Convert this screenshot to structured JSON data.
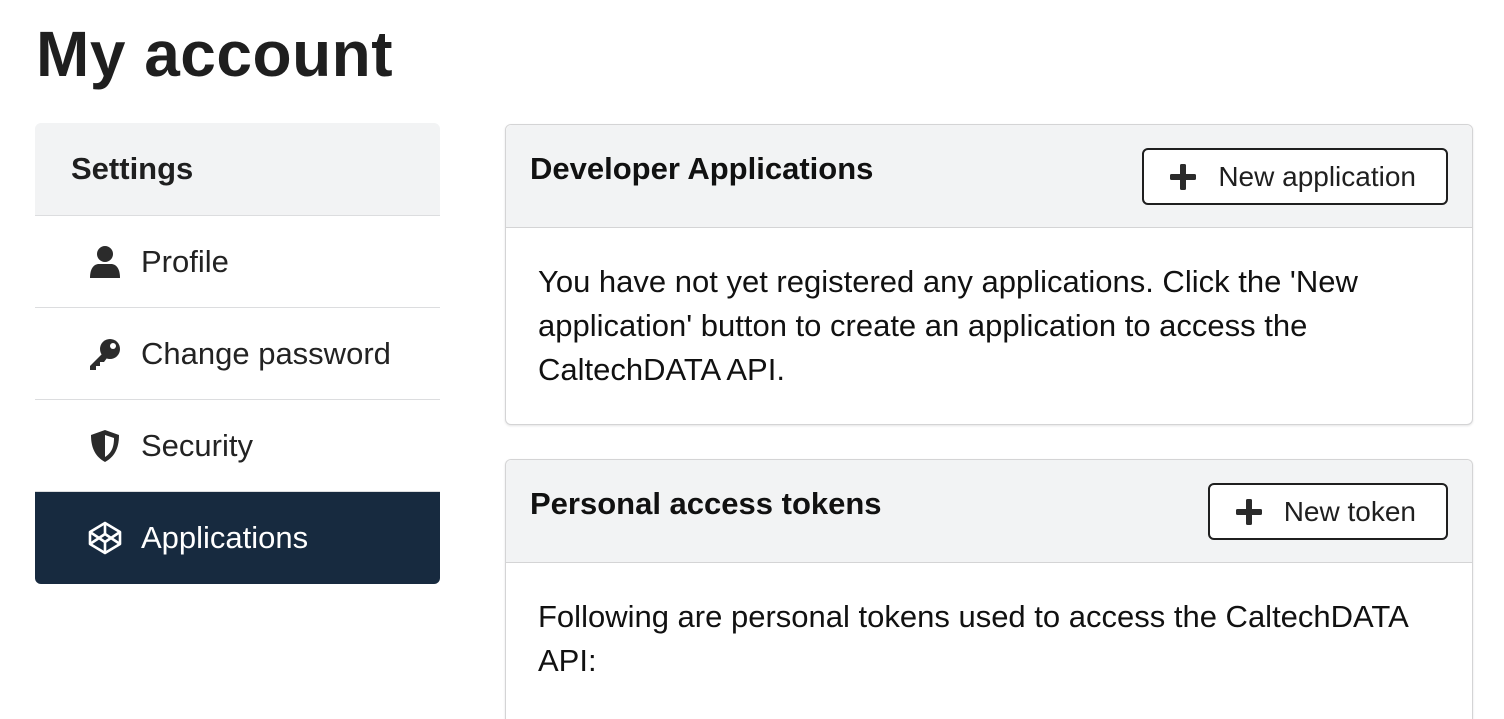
{
  "page": {
    "title": "My account"
  },
  "sidebar": {
    "header": "Settings",
    "items": [
      {
        "label": "Profile",
        "icon": "user-icon",
        "active": false
      },
      {
        "label": "Change password",
        "icon": "key-icon",
        "active": false
      },
      {
        "label": "Security",
        "icon": "shield-icon",
        "active": false
      },
      {
        "label": "Applications",
        "icon": "codepen-icon",
        "active": true
      }
    ]
  },
  "developer_applications": {
    "title": "Developer Applications",
    "button_label": "New application",
    "body": "You have not yet registered any applications. Click the 'New application' button to create an application to access the CaltechDATA API."
  },
  "personal_tokens": {
    "title": "Personal access tokens",
    "button_label": "New token",
    "body": "Following are personal tokens used to access the CaltechDATA API:"
  },
  "colors": {
    "active_bg": "#172a3f",
    "header_bg": "#f2f3f4"
  }
}
